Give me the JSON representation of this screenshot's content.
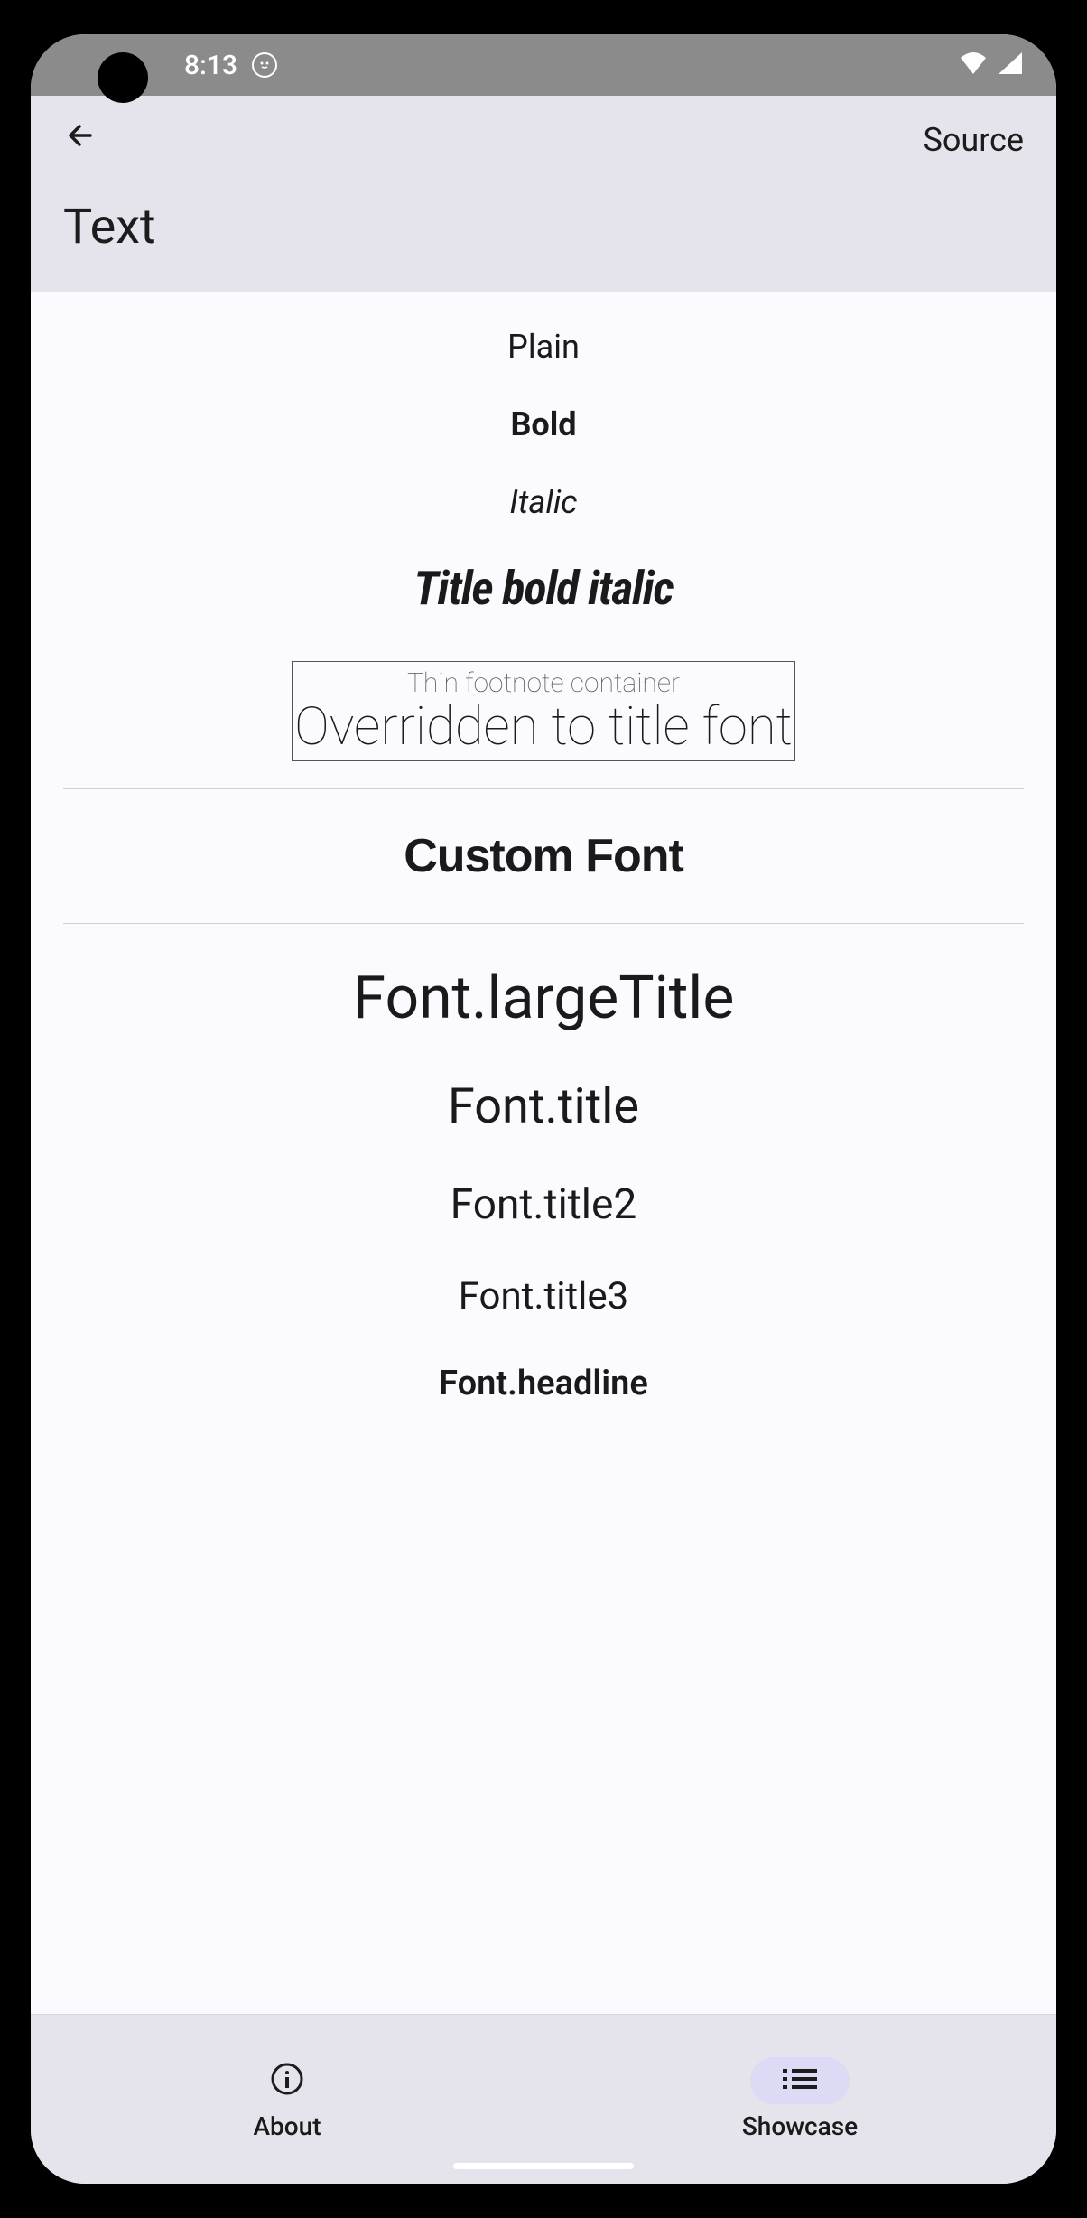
{
  "status": {
    "time": "8:13"
  },
  "header": {
    "source_label": "Source",
    "title": "Text"
  },
  "samples": {
    "plain": "Plain",
    "bold": "Bold",
    "italic": "Italic",
    "title_bold_italic": "Title bold italic",
    "footnote": "Thin footnote container",
    "overridden": "Overridden to title font",
    "custom_font": "Custom Font",
    "large_title": "Font.largeTitle",
    "title": "Font.title",
    "title2": "Font.title2",
    "title3": "Font.title3",
    "headline": "Font.headline"
  },
  "nav": {
    "about": "About",
    "showcase": "Showcase"
  }
}
